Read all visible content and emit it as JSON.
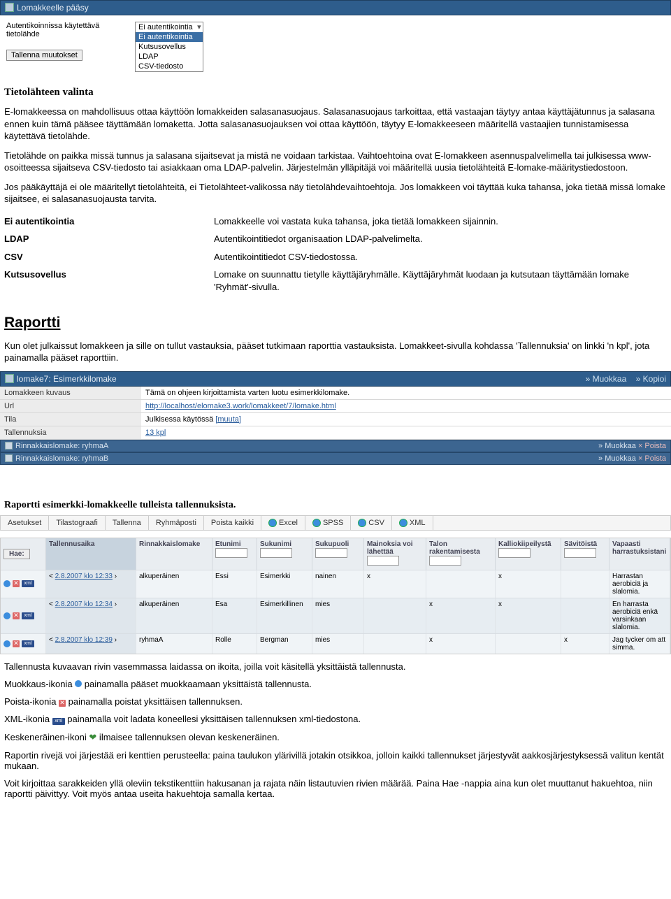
{
  "panel1": {
    "title": "Lomakkeelle pääsy"
  },
  "topform": {
    "label": "Autentikoinnissa käytettävä tietolähde",
    "dropdown": {
      "selected": "Ei autentikointia",
      "options": [
        "Ei autentikointia",
        "Kutsusovellus",
        "LDAP",
        "CSV-tiedosto"
      ]
    },
    "save": "Tallenna muutokset"
  },
  "section1_title": "Tietolähteen valinta",
  "doc_p1": "E-lomakkeessa on mahdollisuus ottaa käyttöön lomakkeiden salasanasuojaus. Salasanasuojaus tarkoittaa, että vastaajan täytyy antaa käyttäjätunnus ja salasana ennen kuin tämä pääsee täyttämään lomaketta. Jotta salasanasuojauksen voi ottaa käyttöön, täytyy E-lomakkeeseen määritellä vastaajien tunnistamisessa käytettävä tietolähde.",
  "doc_p2": "Tietolähde on paikka missä tunnus ja salasana sijaitsevat ja mistä ne voidaan tarkistaa. Vaihtoehtoina ovat E-lomakkeen asennuspalvelimella tai julkisessa www-osoitteessa sijaitseva CSV-tiedosto tai asiakkaan oma LDAP-palvelin. Järjestelmän ylläpitäjä voi määritellä uusia tietolähteitä E-lomake-määritystiedostoon.",
  "doc_p3": "Jos pääkäyttäjä ei ole määritellyt tietolähteitä, ei Tietolähteet-valikossa näy tietolähdevaihtoehtoja. Jos lomakkeen voi täyttää kuka tahansa, joka tietää missä lomake sijaitsee, ei salasanasuojausta tarvita.",
  "defs": [
    {
      "k": "Ei autentikointia",
      "v": "Lomakkeelle voi vastata kuka tahansa, joka tietää lomakkeen sijainnin."
    },
    {
      "k": "LDAP",
      "v": "Autentikointitiedot organisaation LDAP-palvelimelta."
    },
    {
      "k": "CSV",
      "v": "Autentikointitiedot CSV-tiedostossa."
    },
    {
      "k": "Kutsusovellus",
      "v": "Lomake on suunnattu tietylle käyttäjäryhmälle. Käyttäjäryhmät luodaan ja kutsutaan täyttämään lomake 'Ryhmät'-sivulla."
    }
  ],
  "raportti_heading": "Raportti",
  "raportti_intro": "Kun olet julkaissut lomakkeen ja sille on tullut vastauksia, pääset tutkimaan raporttia vastauksista. Lomakkeet-sivulla kohdassa 'Tallennuksia' on linkki 'n kpl', jota painamalla pääset raporttiin.",
  "panel2": {
    "title": "lomake7: Esimerkkilomake",
    "right_edit": "Muokkaa",
    "right_copy": "Kopioi",
    "rows": [
      {
        "lab": "Lomakkeen kuvaus",
        "val": "Tämä on ohjeen kirjoittamista varten luotu esimerkkilomake."
      },
      {
        "lab": "Url",
        "val": "http://localhost/elomake3.work/lomakkeet/7/lomake.html",
        "link": true
      },
      {
        "lab": "Tila",
        "val": "Julkisessa käytössä",
        "suffix": "[muuta]"
      },
      {
        "lab": "Tallennuksia",
        "val": "13 kpl",
        "link": true
      }
    ],
    "sub": [
      {
        "title": "Rinnakkaislomake: ryhmaA",
        "r1": "Muokkaa",
        "r2": "Poista"
      },
      {
        "title": "Rinnakkaislomake: ryhmaB",
        "r1": "Muokkaa",
        "r2": "Poista"
      }
    ]
  },
  "report_head": "Raportti esimerkki-lomakkeelle tulleista tallennuksista.",
  "toolbar": [
    "Asetukset",
    "Tilastograafi",
    "Tallenna",
    "Ryhmäposti",
    "Poista kaikki"
  ],
  "exports": [
    "Excel",
    "SPSS",
    "CSV",
    "XML"
  ],
  "grid_hae": "Hae:",
  "grid_headers": [
    "Tallennusaika",
    "Rinnakkaislomake",
    "Etunimi",
    "Sukunimi",
    "Sukupuoli",
    "Mainoksia voi lähettää",
    "Talon rakentamisesta",
    "Kalliokiipeilystä",
    "Sävitöistä",
    "Vapaasti harrastuksistani"
  ],
  "grid_rows": [
    {
      "time": "2.8.2007 klo 12:33",
      "rink": "alkuperäinen",
      "etu": "Essi",
      "suku": "Esimerkki",
      "sp": "nainen",
      "m": "x",
      "talo": "",
      "kal": "x",
      "sav": "",
      "vap": "Harrastan aerobiciä ja slalomia."
    },
    {
      "time": "2.8.2007 klo 12:34",
      "rink": "alkuperäinen",
      "etu": "Esa",
      "suku": "Esimerkillinen",
      "sp": "mies",
      "m": "",
      "talo": "x",
      "kal": "x",
      "sav": "",
      "vap": "En harrasta aerobiciä enkä varsinkaan slalomia."
    },
    {
      "time": "2.8.2007 klo 12:39",
      "rink": "ryhmaA",
      "etu": "Rolle",
      "suku": "Bergman",
      "sp": "mies",
      "m": "",
      "talo": "x",
      "kal": "",
      "sav": "x",
      "vap": "Jag tycker om att simma."
    }
  ],
  "foot_p1": "Tallennusta kuvaavan rivin vasemmassa laidassa on ikoita, joilla voit käsitellä yksittäistä tallennusta.",
  "foot_edit_a": "Muokkaus-ikonia ",
  "foot_edit_b": " painamalla pääset muokkaamaan yksittäistä tallennusta.",
  "foot_del_a": "Poista-ikonia ",
  "foot_del_b": " painamalla poistat yksittäisen tallennuksen.",
  "foot_xml_a": "XML-ikonia ",
  "foot_xml_b": " painamalla voit ladata koneellesi yksittäisen tallennuksen xml-tiedostona.",
  "foot_kesken_a": "Keskeneräinen-ikoni ",
  "foot_kesken_b": " ilmaisee tallennuksen olevan keskeneräinen.",
  "foot_p2": "Raportin rivejä voi järjestää eri kenttien perusteella: paina taulukon ylärivillä jotakin otsikkoa, jolloin kaikki tallennukset järjestyvät aakkosjärjestyksessä valitun kentät mukaan.",
  "foot_p3": "Voit kirjoittaa sarakkeiden yllä oleviin tekstikenttiin hakusanan ja rajata näin listautuvien rivien määrää. Paina Hae -nappia aina kun olet muuttanut hakuehtoa, niin raportti päivittyy. Voit myös antaa useita hakuehtoja samalla kertaa.",
  "chevron": "<"
}
